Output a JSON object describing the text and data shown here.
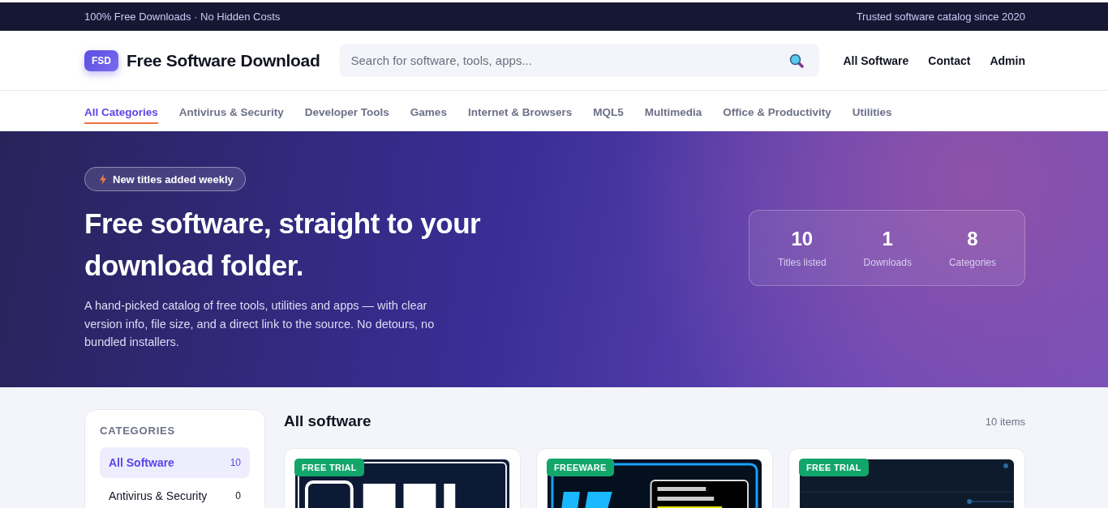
{
  "top_bar": {
    "left": "100% Free Downloads · No Hidden Costs",
    "right": "Trusted software catalog since 2020"
  },
  "header": {
    "logo_badge": "FSD",
    "brand": "Free Software Download",
    "search": {
      "placeholder": "Search for software, tools, apps..."
    },
    "nav": [
      "All Software",
      "Contact",
      "Admin"
    ]
  },
  "category_tabs": [
    {
      "label": "All Categories",
      "selected": true
    },
    {
      "label": "Antivirus & Security",
      "selected": false
    },
    {
      "label": "Developer Tools",
      "selected": false
    },
    {
      "label": "Games",
      "selected": false
    },
    {
      "label": "Internet & Browsers",
      "selected": false
    },
    {
      "label": "MQL5",
      "selected": false
    },
    {
      "label": "Multimedia",
      "selected": false
    },
    {
      "label": "Office & Productivity",
      "selected": false
    },
    {
      "label": "Utilities",
      "selected": false
    }
  ],
  "hero": {
    "badge": "New titles added weekly",
    "title": "Free software, straight to your download folder.",
    "description": "A hand-picked catalog of free tools, utilities and apps — with clear version info, file size, and a direct link to the source. No detours, no bundled installers.",
    "stats": [
      {
        "value": "10",
        "label": "Titles listed"
      },
      {
        "value": "1",
        "label": "Downloads"
      },
      {
        "value": "8",
        "label": "Categories"
      }
    ]
  },
  "sidebar": {
    "heading": "CATEGORIES",
    "items": [
      {
        "label": "All Software",
        "count": "10",
        "selected": true
      },
      {
        "label": "Antivirus & Security",
        "count": "0",
        "selected": false
      }
    ]
  },
  "listing": {
    "title": "All software",
    "count": "10 items",
    "cards": [
      {
        "tag": "FREE TRIAL",
        "kind": "picture"
      },
      {
        "tag": "FREEWARE",
        "kind": "picture"
      },
      {
        "tag": "FREE TRIAL",
        "kind": "picture"
      }
    ]
  }
}
